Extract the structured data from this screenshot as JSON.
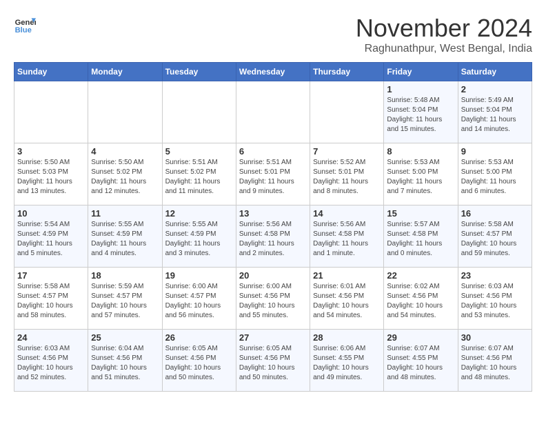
{
  "header": {
    "logo_line1": "General",
    "logo_line2": "Blue",
    "month": "November 2024",
    "location": "Raghunathpur, West Bengal, India"
  },
  "days_of_week": [
    "Sunday",
    "Monday",
    "Tuesday",
    "Wednesday",
    "Thursday",
    "Friday",
    "Saturday"
  ],
  "weeks": [
    [
      {
        "day": "",
        "info": ""
      },
      {
        "day": "",
        "info": ""
      },
      {
        "day": "",
        "info": ""
      },
      {
        "day": "",
        "info": ""
      },
      {
        "day": "",
        "info": ""
      },
      {
        "day": "1",
        "info": "Sunrise: 5:48 AM\nSunset: 5:04 PM\nDaylight: 11 hours and 15 minutes."
      },
      {
        "day": "2",
        "info": "Sunrise: 5:49 AM\nSunset: 5:04 PM\nDaylight: 11 hours and 14 minutes."
      }
    ],
    [
      {
        "day": "3",
        "info": "Sunrise: 5:50 AM\nSunset: 5:03 PM\nDaylight: 11 hours and 13 minutes."
      },
      {
        "day": "4",
        "info": "Sunrise: 5:50 AM\nSunset: 5:02 PM\nDaylight: 11 hours and 12 minutes."
      },
      {
        "day": "5",
        "info": "Sunrise: 5:51 AM\nSunset: 5:02 PM\nDaylight: 11 hours and 11 minutes."
      },
      {
        "day": "6",
        "info": "Sunrise: 5:51 AM\nSunset: 5:01 PM\nDaylight: 11 hours and 9 minutes."
      },
      {
        "day": "7",
        "info": "Sunrise: 5:52 AM\nSunset: 5:01 PM\nDaylight: 11 hours and 8 minutes."
      },
      {
        "day": "8",
        "info": "Sunrise: 5:53 AM\nSunset: 5:00 PM\nDaylight: 11 hours and 7 minutes."
      },
      {
        "day": "9",
        "info": "Sunrise: 5:53 AM\nSunset: 5:00 PM\nDaylight: 11 hours and 6 minutes."
      }
    ],
    [
      {
        "day": "10",
        "info": "Sunrise: 5:54 AM\nSunset: 4:59 PM\nDaylight: 11 hours and 5 minutes."
      },
      {
        "day": "11",
        "info": "Sunrise: 5:55 AM\nSunset: 4:59 PM\nDaylight: 11 hours and 4 minutes."
      },
      {
        "day": "12",
        "info": "Sunrise: 5:55 AM\nSunset: 4:59 PM\nDaylight: 11 hours and 3 minutes."
      },
      {
        "day": "13",
        "info": "Sunrise: 5:56 AM\nSunset: 4:58 PM\nDaylight: 11 hours and 2 minutes."
      },
      {
        "day": "14",
        "info": "Sunrise: 5:56 AM\nSunset: 4:58 PM\nDaylight: 11 hours and 1 minute."
      },
      {
        "day": "15",
        "info": "Sunrise: 5:57 AM\nSunset: 4:58 PM\nDaylight: 11 hours and 0 minutes."
      },
      {
        "day": "16",
        "info": "Sunrise: 5:58 AM\nSunset: 4:57 PM\nDaylight: 10 hours and 59 minutes."
      }
    ],
    [
      {
        "day": "17",
        "info": "Sunrise: 5:58 AM\nSunset: 4:57 PM\nDaylight: 10 hours and 58 minutes."
      },
      {
        "day": "18",
        "info": "Sunrise: 5:59 AM\nSunset: 4:57 PM\nDaylight: 10 hours and 57 minutes."
      },
      {
        "day": "19",
        "info": "Sunrise: 6:00 AM\nSunset: 4:57 PM\nDaylight: 10 hours and 56 minutes."
      },
      {
        "day": "20",
        "info": "Sunrise: 6:00 AM\nSunset: 4:56 PM\nDaylight: 10 hours and 55 minutes."
      },
      {
        "day": "21",
        "info": "Sunrise: 6:01 AM\nSunset: 4:56 PM\nDaylight: 10 hours and 54 minutes."
      },
      {
        "day": "22",
        "info": "Sunrise: 6:02 AM\nSunset: 4:56 PM\nDaylight: 10 hours and 54 minutes."
      },
      {
        "day": "23",
        "info": "Sunrise: 6:03 AM\nSunset: 4:56 PM\nDaylight: 10 hours and 53 minutes."
      }
    ],
    [
      {
        "day": "24",
        "info": "Sunrise: 6:03 AM\nSunset: 4:56 PM\nDaylight: 10 hours and 52 minutes."
      },
      {
        "day": "25",
        "info": "Sunrise: 6:04 AM\nSunset: 4:56 PM\nDaylight: 10 hours and 51 minutes."
      },
      {
        "day": "26",
        "info": "Sunrise: 6:05 AM\nSunset: 4:56 PM\nDaylight: 10 hours and 50 minutes."
      },
      {
        "day": "27",
        "info": "Sunrise: 6:05 AM\nSunset: 4:56 PM\nDaylight: 10 hours and 50 minutes."
      },
      {
        "day": "28",
        "info": "Sunrise: 6:06 AM\nSunset: 4:55 PM\nDaylight: 10 hours and 49 minutes."
      },
      {
        "day": "29",
        "info": "Sunrise: 6:07 AM\nSunset: 4:55 PM\nDaylight: 10 hours and 48 minutes."
      },
      {
        "day": "30",
        "info": "Sunrise: 6:07 AM\nSunset: 4:56 PM\nDaylight: 10 hours and 48 minutes."
      }
    ]
  ]
}
